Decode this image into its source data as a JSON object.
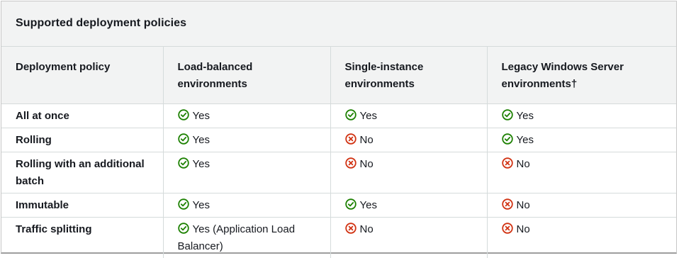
{
  "caption": "Supported deployment policies",
  "headers": [
    "Deployment policy",
    "Load-balanced environments",
    "Single-instance environments",
    "Legacy Windows Server environments†"
  ],
  "icons": {
    "yes": "check-circle-icon",
    "no": "x-circle-icon"
  },
  "colors": {
    "yes": "#1d8102",
    "no": "#d13212"
  },
  "rows": [
    {
      "policy": "All at once",
      "cells": [
        {
          "status": "yes",
          "text": "Yes"
        },
        {
          "status": "yes",
          "text": "Yes"
        },
        {
          "status": "yes",
          "text": "Yes"
        }
      ]
    },
    {
      "policy": "Rolling",
      "cells": [
        {
          "status": "yes",
          "text": "Yes"
        },
        {
          "status": "no",
          "text": "No"
        },
        {
          "status": "yes",
          "text": "Yes"
        }
      ]
    },
    {
      "policy": "Rolling with an additional batch",
      "cells": [
        {
          "status": "yes",
          "text": "Yes"
        },
        {
          "status": "no",
          "text": "No"
        },
        {
          "status": "no",
          "text": "No"
        }
      ]
    },
    {
      "policy": "Immutable",
      "cells": [
        {
          "status": "yes",
          "text": "Yes"
        },
        {
          "status": "yes",
          "text": "Yes"
        },
        {
          "status": "no",
          "text": "No"
        }
      ]
    },
    {
      "policy": "Traffic splitting",
      "cells": [
        {
          "status": "yes",
          "text": "Yes (Application Load Balancer)"
        },
        {
          "status": "no",
          "text": "No"
        },
        {
          "status": "no",
          "text": "No"
        }
      ]
    }
  ]
}
